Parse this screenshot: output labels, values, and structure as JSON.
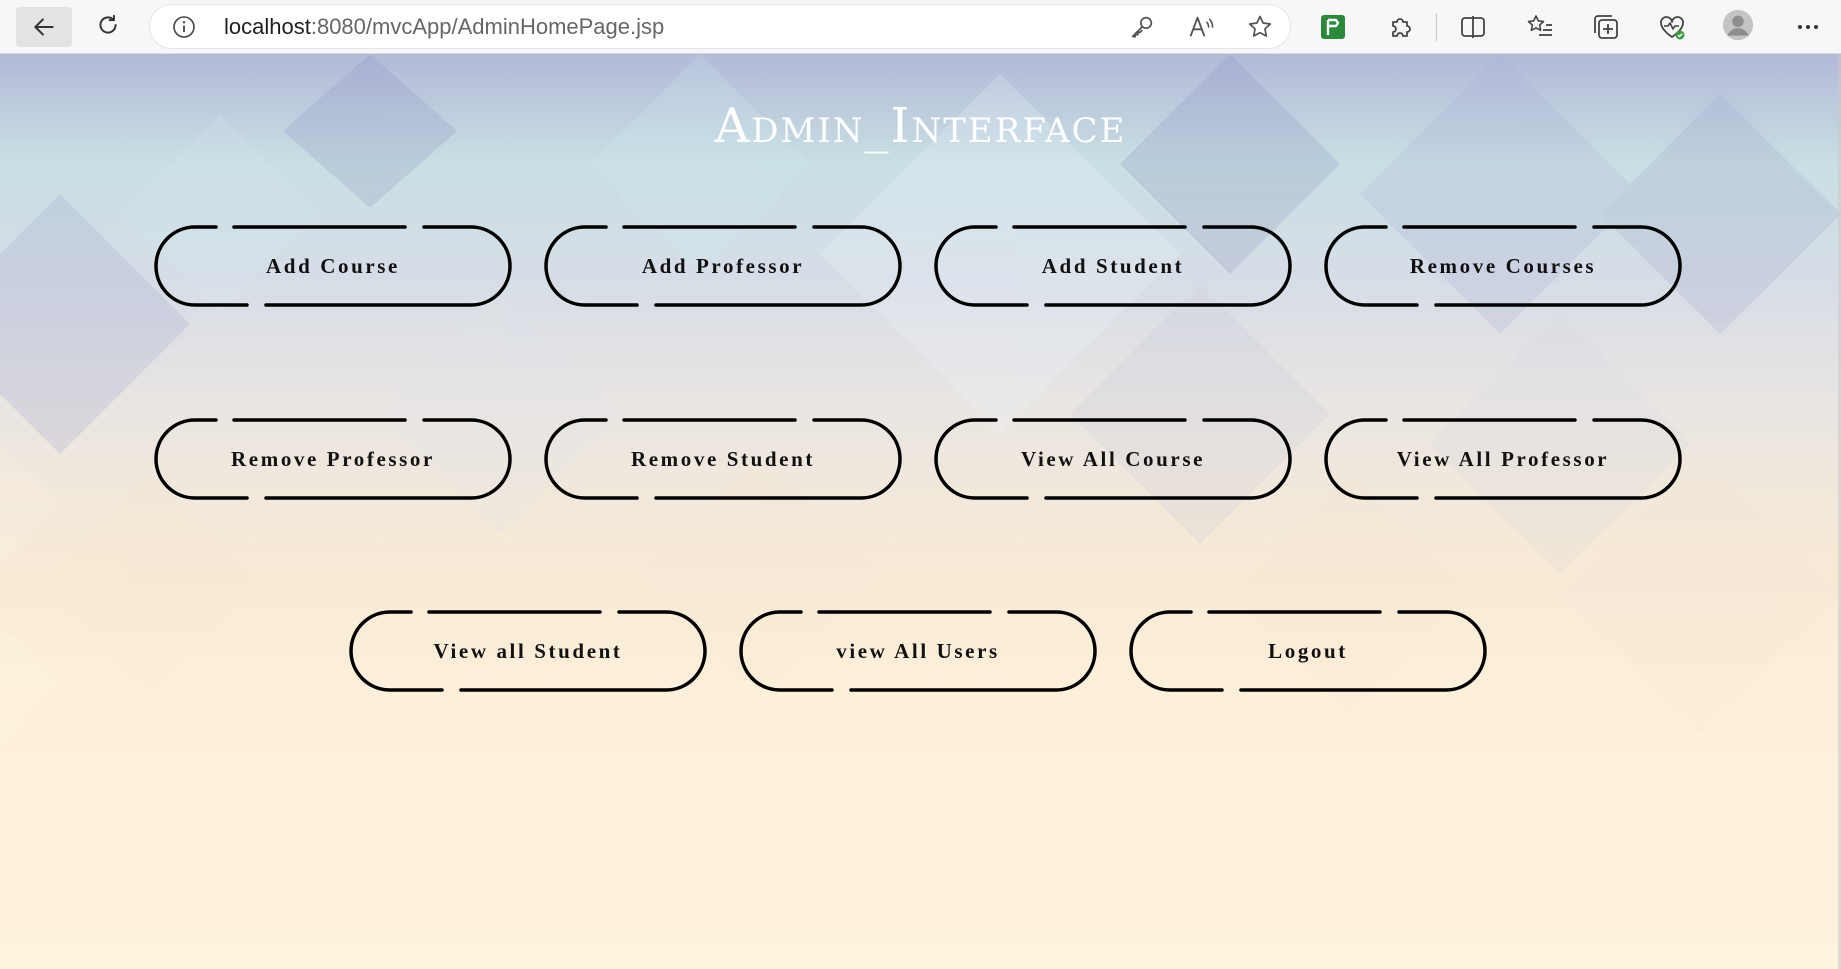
{
  "browser": {
    "url_host": "localhost",
    "url_rest": ":8080/mvcApp/AdminHomePage.jsp",
    "icons": {
      "back": "back-arrow-icon",
      "reload": "reload-icon",
      "info": "info-icon",
      "key": "key-icon",
      "read_aloud": "read-aloud-icon",
      "favorite": "star-icon",
      "extension_green": "green-extension-icon",
      "extensions": "puzzle-icon",
      "split_screen": "split-screen-icon",
      "favorites": "favorites-list-icon",
      "collections": "collections-icon",
      "performance": "heart-pulse-icon",
      "profile": "profile-avatar-icon",
      "more": "more-dots-icon"
    }
  },
  "page": {
    "title": "Admin_Interface",
    "buttons": [
      {
        "label": "Add Course"
      },
      {
        "label": "Add Professor"
      },
      {
        "label": "Add Student"
      },
      {
        "label": "Remove Courses"
      },
      {
        "label": "Remove Professor"
      },
      {
        "label": "Remove Student"
      },
      {
        "label": "View All Course"
      },
      {
        "label": "View All Professor"
      },
      {
        "label": "View all Student"
      },
      {
        "label": "view All Users"
      },
      {
        "label": "Logout"
      }
    ]
  },
  "colors": {
    "title_text": "#ffffff",
    "button_border": "#000000",
    "button_text": "#111111",
    "background_top": "#b3b9d8",
    "background_bottom": "#fef3dd"
  }
}
